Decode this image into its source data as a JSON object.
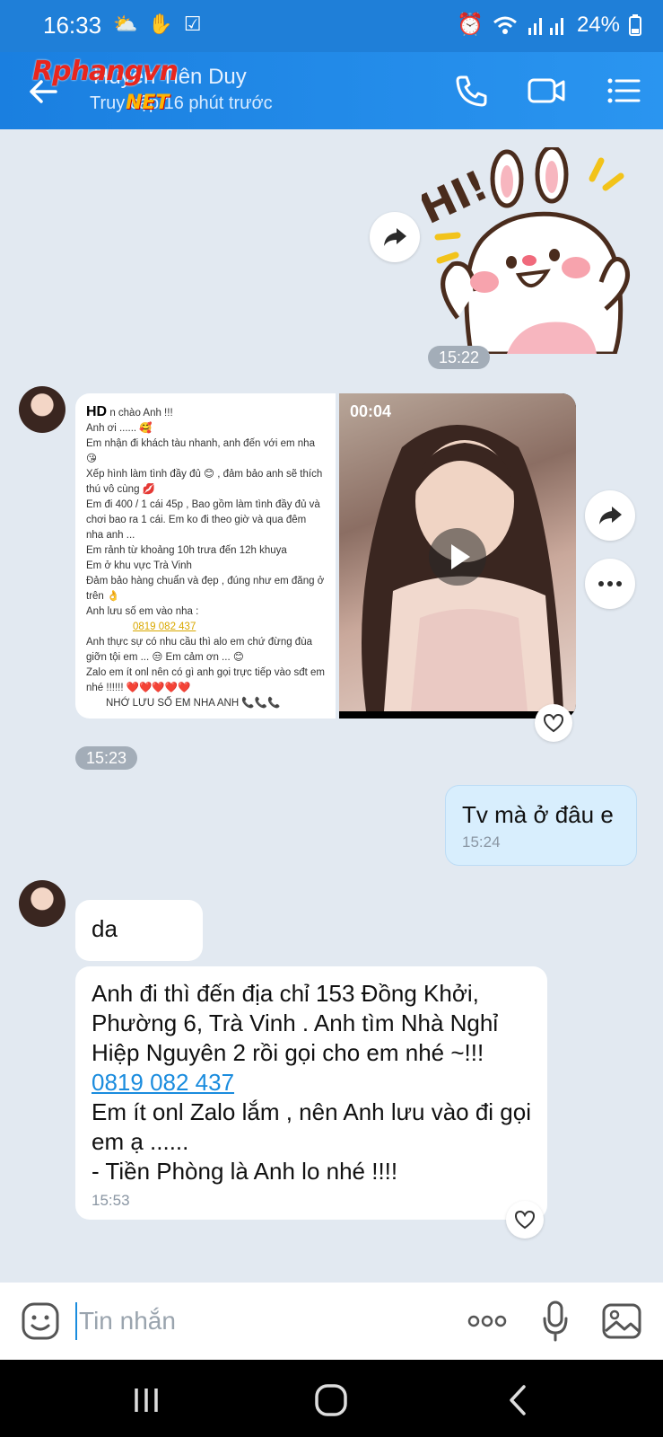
{
  "status_bar": {
    "time": "16:33",
    "battery": "24%"
  },
  "header": {
    "title": "Huyền Tiên Duy",
    "subtitle": "Truy cập 16 phút trước",
    "watermark_top": "Rphangvn",
    "watermark_bottom": "NET",
    "accent": "#1f7fd8"
  },
  "messages": {
    "time_1": "15:22",
    "card": {
      "hd": "HD",
      "lines": [
        "n chào Anh !!!",
        "Anh ơi ...... 🥰",
        "Em nhận đi khách tàu nhanh, anh đến với em nha 😘",
        "Xếp hình làm tình đầy đủ 😊 , đảm bảo anh sẽ thích thú vô cùng 💋",
        "Em đi 400 / 1 cái 45p , Bao gồm làm tình đầy đủ và chơi bao ra 1 cái. Em ko đi theo giờ và qua đêm nha anh ...",
        "Em rảnh từ khoảng 10h trưa đến 12h khuya",
        "Em ở khu vực Trà Vinh",
        "Đảm bảo hàng chuẩn và đẹp , đúng như em đăng ở trên 👌",
        "Anh lưu số em vào nha :"
      ],
      "phone": "0819 082 437",
      "lines_after": [
        "Anh thực sự có nhu cầu thì alo em chứ đừng đùa giỡn tội em ... 😒 Em cảm ơn ... 😊",
        "Zalo em ít onl nên có gì anh gọi trực tiếp vào sđt em nhé !!!!!! ❤️❤️❤️❤️❤️",
        "NHỚ LƯU SỐ EM NHA ANH 📞📞📞"
      ]
    },
    "video_duration": "00:04",
    "time_2": "15:23",
    "out_text": "Tv mà ở đâu e",
    "out_time": "15:24",
    "in_short": "da",
    "in_long_1": "Anh đi thì đến địa chỉ 153 Đồng Khởi, Phường 6, Trà Vinh . Anh tìm Nhà Nghỉ Hiệp Nguyên 2 rồi gọi cho em nhé ~!!!",
    "in_long_phone": "0819 082 437",
    "in_long_2": "Em ít onl Zalo lắm , nên Anh lưu vào đi gọi em ạ ......",
    "in_long_3": "- Tiền Phòng là Anh lo nhé !!!!",
    "in_long_time": "15:53"
  },
  "input": {
    "placeholder": "Tin nhắn"
  },
  "icons": {
    "share": "share-icon",
    "more": "more-icon",
    "heart": "heart-icon",
    "call": "phone-icon",
    "video": "video-camera-icon",
    "menu": "menu-icon"
  }
}
